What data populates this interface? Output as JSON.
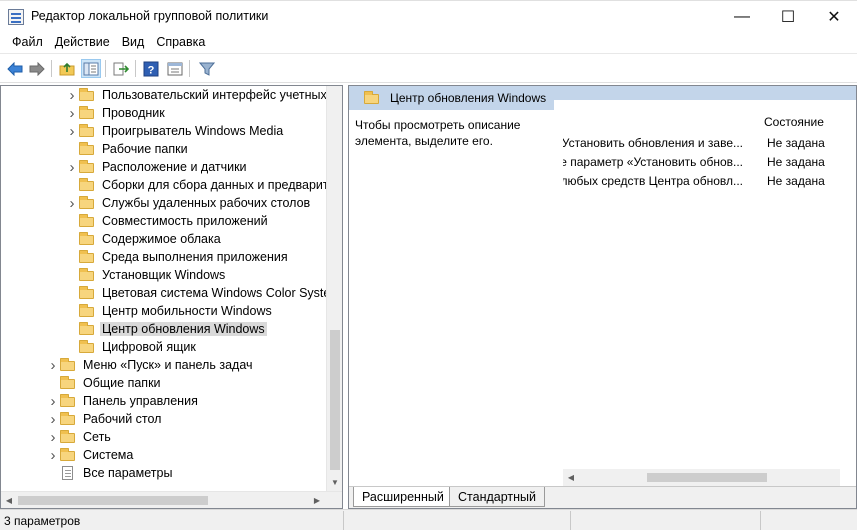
{
  "window": {
    "title": "Редактор локальной групповой политики",
    "minimize_glyph": "—",
    "maximize_glyph": "☐",
    "close_glyph": "✕"
  },
  "menu": [
    "Файл",
    "Действие",
    "Вид",
    "Справка"
  ],
  "toolbar": {
    "buttons": [
      "back-icon",
      "forward-icon",
      "up-folder-icon",
      "show-hide-tree-icon",
      "export-list-icon",
      "help-icon",
      "properties-icon",
      "filter-icon"
    ]
  },
  "tree": {
    "items": [
      {
        "label": "Пользовательский интерфейс учетных д",
        "expandable": true,
        "indent": 1,
        "icon": "folder-icon"
      },
      {
        "label": "Проводник",
        "expandable": true,
        "indent": 1,
        "icon": "folder-icon"
      },
      {
        "label": "Проигрыватель Windows Media",
        "expandable": true,
        "indent": 1,
        "icon": "folder-icon"
      },
      {
        "label": "Рабочие папки",
        "expandable": false,
        "indent": 1,
        "icon": "folder-icon"
      },
      {
        "label": "Расположение и датчики",
        "expandable": true,
        "indent": 1,
        "icon": "folder-icon"
      },
      {
        "label": "Сборки для сбора данных и предварител",
        "expandable": false,
        "indent": 1,
        "icon": "folder-icon"
      },
      {
        "label": "Службы удаленных рабочих столов",
        "expandable": true,
        "indent": 1,
        "icon": "folder-icon"
      },
      {
        "label": "Совместимость приложений",
        "expandable": false,
        "indent": 1,
        "icon": "folder-icon"
      },
      {
        "label": "Содержимое облака",
        "expandable": false,
        "indent": 1,
        "icon": "folder-icon"
      },
      {
        "label": "Среда выполнения приложения",
        "expandable": false,
        "indent": 1,
        "icon": "folder-icon"
      },
      {
        "label": "Установщик Windows",
        "expandable": false,
        "indent": 1,
        "icon": "folder-icon"
      },
      {
        "label": "Цветовая система Windows Color System",
        "expandable": false,
        "indent": 1,
        "icon": "folder-icon"
      },
      {
        "label": "Центр мобильности Windows",
        "expandable": false,
        "indent": 1,
        "icon": "folder-icon"
      },
      {
        "label": "Центр обновления Windows",
        "expandable": false,
        "indent": 1,
        "icon": "folder-icon",
        "selected": true
      },
      {
        "label": "Цифровой ящик",
        "expandable": false,
        "indent": 1,
        "icon": "folder-icon"
      },
      {
        "label": "Меню «Пуск» и панель задач",
        "expandable": true,
        "indent": 0,
        "icon": "folder-icon"
      },
      {
        "label": "Общие папки",
        "expandable": false,
        "indent": 0,
        "icon": "folder-icon"
      },
      {
        "label": "Панель управления",
        "expandable": true,
        "indent": 0,
        "icon": "folder-icon"
      },
      {
        "label": "Рабочий стол",
        "expandable": true,
        "indent": 0,
        "icon": "folder-icon"
      },
      {
        "label": "Сеть",
        "expandable": true,
        "indent": 0,
        "icon": "folder-icon"
      },
      {
        "label": "Система",
        "expandable": true,
        "indent": 0,
        "icon": "folder-icon"
      },
      {
        "label": "Все параметры",
        "expandable": false,
        "indent": 0,
        "icon": "settings-page-icon"
      }
    ]
  },
  "details": {
    "header_title": "Центр обновления Windows",
    "description": "Чтобы просмотреть описание элемента, выделите его.",
    "column_state": "Состояние",
    "rows": [
      {
        "name": "Установить обновления и заве...",
        "state": "Не задана"
      },
      {
        "name": "е параметр «Установить обнов...",
        "state": "Не задана"
      },
      {
        "name": "ь любых средств Центра обновл...",
        "state": "Не задана"
      }
    ]
  },
  "tabs": [
    "Расширенный",
    "Стандартный"
  ],
  "status": {
    "text": "3 параметров"
  }
}
